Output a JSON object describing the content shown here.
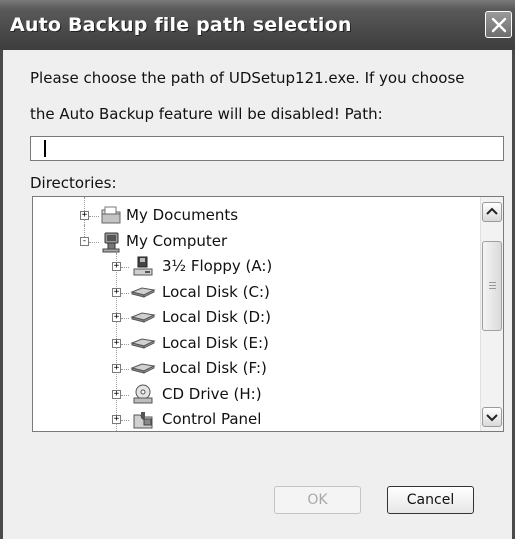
{
  "window": {
    "title": "Auto Backup file path selection"
  },
  "prompt": {
    "line1": "Please choose the path of UDSetup121.exe. If you choose",
    "line2": "the Auto Backup feature will be disabled! Path:"
  },
  "path_input": {
    "value": ""
  },
  "directories": {
    "label": "Directories:",
    "items": [
      {
        "label": "My Documents",
        "icon": "folder-documents-icon",
        "level": 1,
        "expander": "+"
      },
      {
        "label": "My Computer",
        "icon": "computer-icon",
        "level": 1,
        "expander": "-"
      },
      {
        "label": "3½ Floppy (A:)",
        "icon": "floppy-drive-icon",
        "level": 2,
        "expander": "+"
      },
      {
        "label": "Local Disk (C:)",
        "icon": "hard-disk-icon",
        "level": 2,
        "expander": "+"
      },
      {
        "label": "Local Disk (D:)",
        "icon": "hard-disk-icon",
        "level": 2,
        "expander": "+"
      },
      {
        "label": "Local Disk (E:)",
        "icon": "hard-disk-icon",
        "level": 2,
        "expander": "+"
      },
      {
        "label": "Local Disk (F:)",
        "icon": "hard-disk-icon",
        "level": 2,
        "expander": "+"
      },
      {
        "label": "CD Drive (H:)",
        "icon": "cd-drive-icon",
        "level": 2,
        "expander": "+"
      },
      {
        "label": "Control Panel",
        "icon": "control-panel-icon",
        "level": 2,
        "expander": "+"
      }
    ]
  },
  "buttons": {
    "ok": "OK",
    "cancel": "Cancel"
  },
  "colors": {
    "titlebar": "#4a4a4a",
    "dialog_bg": "#efefef"
  }
}
